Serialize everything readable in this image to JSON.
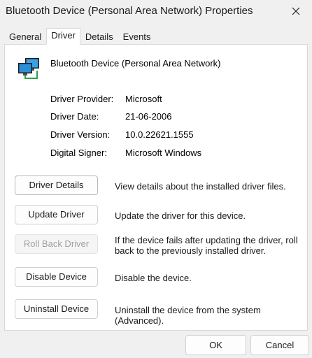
{
  "window": {
    "title": "Bluetooth Device (Personal Area Network) Properties"
  },
  "tabs": [
    {
      "label": "General",
      "active": false
    },
    {
      "label": "Driver",
      "active": true
    },
    {
      "label": "Details",
      "active": false
    },
    {
      "label": "Events",
      "active": false
    }
  ],
  "device": {
    "name": "Bluetooth Device (Personal Area Network)",
    "icon": "network-adapter-icon"
  },
  "driver_info": [
    {
      "label": "Driver Provider:",
      "value": "Microsoft"
    },
    {
      "label": "Driver Date:",
      "value": "21-06-2006"
    },
    {
      "label": "Driver Version:",
      "value": "10.0.22621.1555"
    },
    {
      "label": "Digital Signer:",
      "value": "Microsoft Windows"
    }
  ],
  "actions": [
    {
      "label": "Driver Details",
      "description": "View details about the installed driver files.",
      "enabled": true
    },
    {
      "label": "Update Driver",
      "description": "Update the driver for this device.",
      "enabled": true
    },
    {
      "label": "Roll Back Driver",
      "description": "If the device fails after updating the driver, roll back to the previously installed driver.",
      "enabled": false
    },
    {
      "label": "Disable Device",
      "description": "Disable the device.",
      "enabled": true
    },
    {
      "label": "Uninstall Device",
      "description": "Uninstall the device from the system (Advanced).",
      "enabled": true
    }
  ],
  "footer": {
    "ok_label": "OK",
    "cancel_label": "Cancel"
  },
  "colors": {
    "window_bg": "#f0f0f0",
    "panel_bg": "#ffffff",
    "disabled_text": "#a0a0a0",
    "icon_blue": "#2b8fd8"
  }
}
